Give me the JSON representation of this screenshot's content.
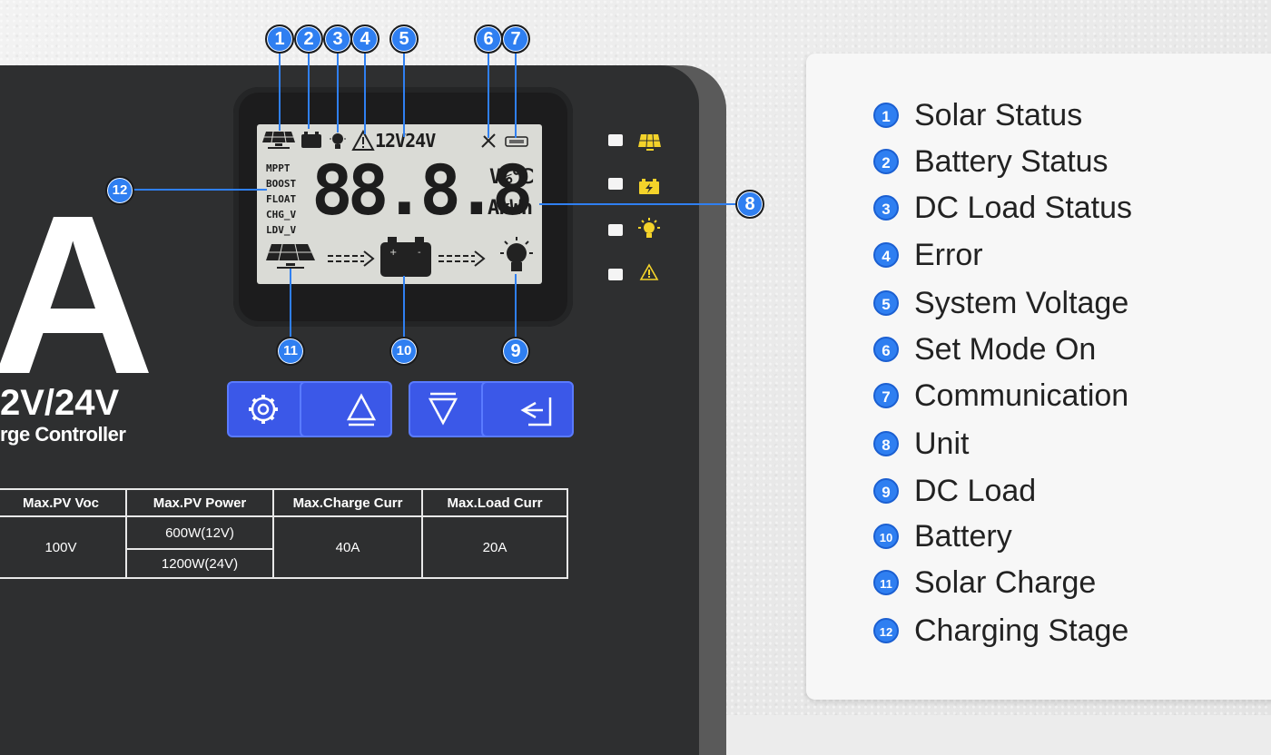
{
  "lcd": {
    "stages": [
      "MPPT",
      "BOOST",
      "FLOAT",
      "CHG_V",
      "LDV_V"
    ],
    "system_voltage": "12V24V",
    "digits": "88.8.8",
    "unit_line1": "V%℃",
    "unit_line2": "AkWh"
  },
  "brand": {
    "big_letter": "A",
    "voltage": "2V/24V",
    "name": "rge Controller"
  },
  "buttons": [
    {
      "icon": "gear-icon"
    },
    {
      "icon": "up-triangle-icon"
    },
    {
      "icon": "down-triangle-icon"
    },
    {
      "icon": "return-arrow-icon"
    }
  ],
  "spec_table": {
    "headers": [
      "Max.PV Voc",
      "Max.PV Power",
      "Max.Charge Curr",
      "Max.Load Curr"
    ],
    "pv_voc": "100V",
    "pv_power": [
      "600W(12V)",
      "1200W(24V)"
    ],
    "charge_curr": "40A",
    "load_curr": "20A"
  },
  "markers": [
    "1",
    "2",
    "3",
    "4",
    "5",
    "6",
    "7",
    "8",
    "9",
    "10",
    "11",
    "12"
  ],
  "legend": [
    {
      "num": "1",
      "label": "Solar Status"
    },
    {
      "num": "2",
      "label": "Battery Status"
    },
    {
      "num": "3",
      "label": "DC Load Status"
    },
    {
      "num": "4",
      "label": "Error"
    },
    {
      "num": "5",
      "label": "System Voltage"
    },
    {
      "num": "6",
      "label": "Set Mode On"
    },
    {
      "num": "7",
      "label": "Communication"
    },
    {
      "num": "8",
      "label": "Unit"
    },
    {
      "num": "9",
      "label": "DC Load"
    },
    {
      "num": "10",
      "label": "Battery"
    },
    {
      "num": "11",
      "label": "Solar Charge"
    },
    {
      "num": "12",
      "label": "Charging Stage"
    }
  ],
  "colors": {
    "marker_blue": "#2f7ff1",
    "button_blue": "#3b58e8",
    "indicator_yellow": "#f4d32a"
  }
}
